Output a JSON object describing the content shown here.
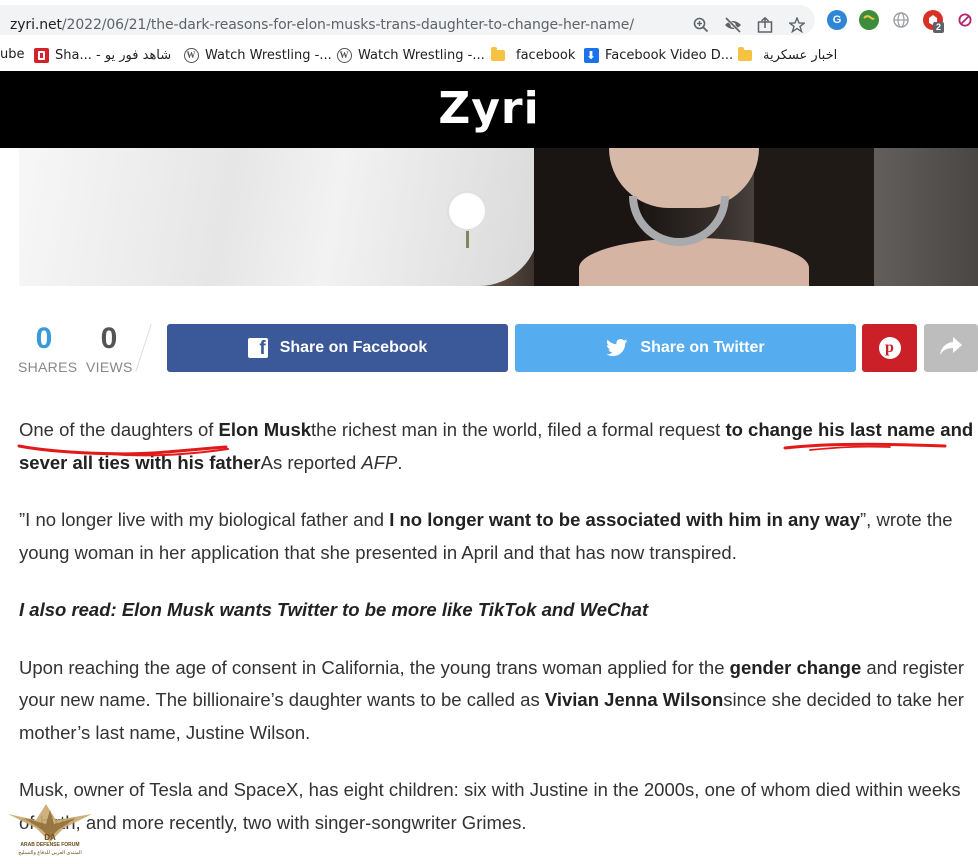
{
  "browser": {
    "url_host": "zyri.net",
    "url_path": "/2022/06/21/the-dark-reasons-for-elon-musks-trans-daughter-to-change-her-name/",
    "icons": [
      "zoom-icon",
      "eye-off-icon",
      "share-icon",
      "star-icon"
    ],
    "extensions": [
      {
        "name": "grammarly-extension-icon",
        "color": "#15c39a",
        "glyph": "G"
      },
      {
        "name": "globe-green-extension-icon",
        "color": "#3c8c3c",
        "glyph": "●"
      },
      {
        "name": "web-extension-icon",
        "color": "#9aa0a6",
        "glyph": "◍"
      },
      {
        "name": "adblock-extension-icon",
        "color": "#d93025",
        "glyph": "◉",
        "badge": "2"
      },
      {
        "name": "block-extension-icon",
        "color": "#9334e6",
        "glyph": "⊘"
      }
    ]
  },
  "bookmarks": [
    {
      "label": "ube",
      "icon": "none"
    },
    {
      "label": "Sha... - شاهد فور يو",
      "icon": "shahid"
    },
    {
      "label": "Watch Wrestling -...",
      "icon": "wordpress"
    },
    {
      "label": "Watch Wrestling -...",
      "icon": "wordpress"
    },
    {
      "label": "facebook",
      "icon": "folder"
    },
    {
      "label": "Facebook Video D...",
      "icon": "download"
    },
    {
      "label": "اخبار عسكرية",
      "icon": "folder"
    }
  ],
  "site": {
    "logo": "Zyri"
  },
  "stats": {
    "shares": {
      "value": "0",
      "label": "SHARES",
      "color": "#3a9ad9"
    },
    "views": {
      "value": "0",
      "label": "VIEWS",
      "color": "#555555"
    }
  },
  "share": {
    "facebook_label": "Share on Facebook",
    "twitter_label": "Share on Twitter"
  },
  "colors": {
    "facebook": "#3b5998",
    "twitter": "#55acee",
    "pinterest": "#cb2027",
    "more": "#bdbdbd",
    "annotation": "#e21a1a"
  },
  "article": {
    "p1": {
      "t1": "One of the daughters of ",
      "b1": "Elon Musk",
      "t2": "the richest man in the world, filed a formal request ",
      "b2": "to change his last name and sever all ties with his father",
      "t3": "As reported ",
      "i1": "AFP",
      "t4": "."
    },
    "p2": {
      "t1": "”I no longer live with my biological father and ",
      "b1": "I no longer want to be associated with him in any way",
      "t2": "”, wrote the young woman in her application that she presented in April and that has now transpired."
    },
    "p3": "I also read: Elon Musk wants Twitter to be more like TikTok and WeChat",
    "p4": {
      "t1": "Upon reaching the age of consent in California, the young trans woman applied for the ",
      "b1": "gender change",
      "t2": " and register your new name. The billionaire’s daughter wants to be called as ",
      "b2": "Vivian Jenna Wilson",
      "t3": "since she decided to take her mother’s last name, Justine Wilson."
    },
    "p5": "Musk, owner of Tesla and SpaceX, has eight children: six with Justine in the 2000s, one of whom died within weeks of birth, and more recently, two with singer-songwriter Grimes."
  },
  "watermark": {
    "initials": "DA",
    "name": "ARAB DEFENSE FORUM",
    "arabic": "المنتدى العربي للدفاع والتسليح"
  }
}
